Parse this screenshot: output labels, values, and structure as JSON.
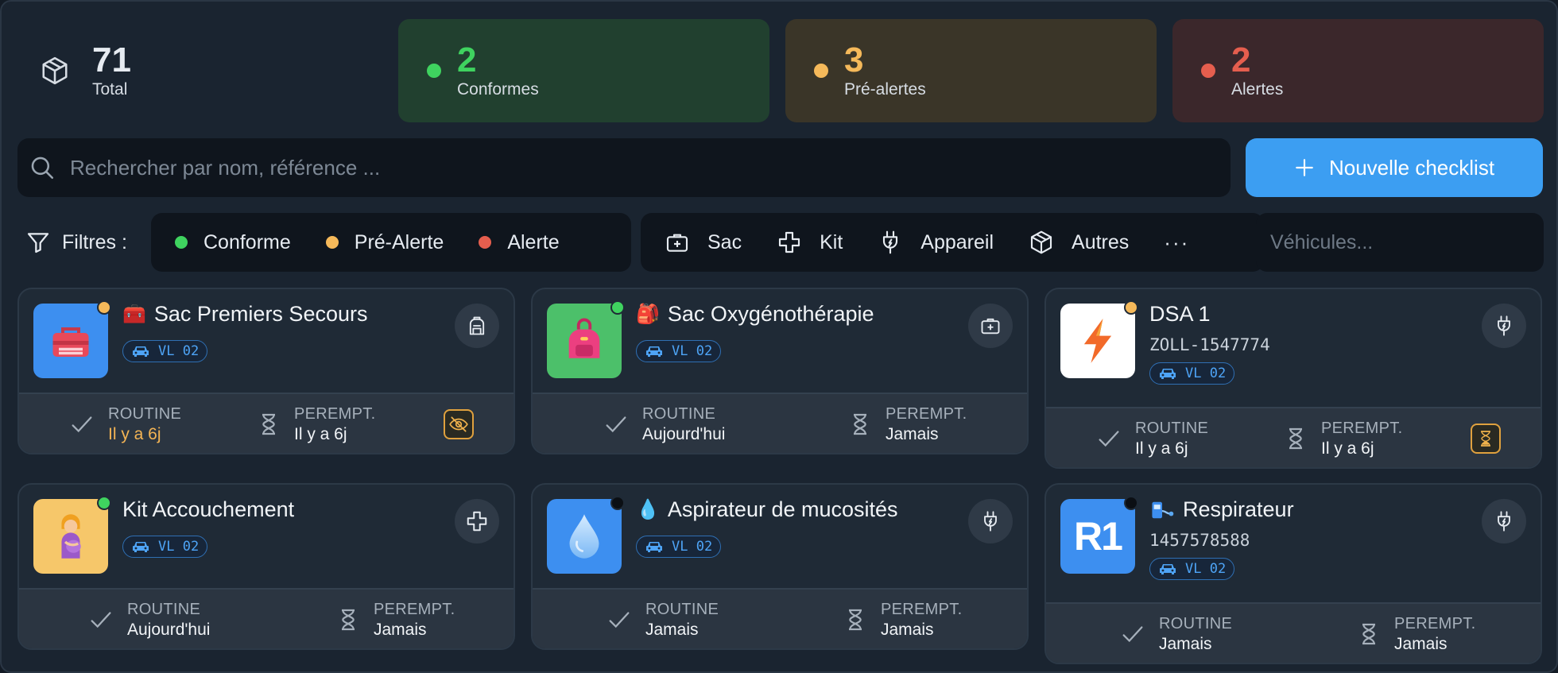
{
  "colors": {
    "ok": "#3fd35f",
    "warn": "#f5b95a",
    "alert": "#e55e4e",
    "accent": "#3c9ef2",
    "vehicle": "#4ea4f6",
    "unknown": "#0b0f14"
  },
  "stats": {
    "total": {
      "value": "71",
      "label": "Total",
      "icon": "box-icon"
    },
    "conformes": {
      "value": "2",
      "label": "Conformes"
    },
    "prealertes": {
      "value": "3",
      "label": "Pré-alertes"
    },
    "alertes": {
      "value": "2",
      "label": "Alertes"
    }
  },
  "search": {
    "placeholder": "Rechercher par nom, référence ...",
    "value": ""
  },
  "new_button": {
    "label": "Nouvelle checklist",
    "icon": "plus-icon"
  },
  "filters": {
    "label": "Filtres :",
    "status": [
      {
        "label": "Conforme",
        "color": "#3fd35f"
      },
      {
        "label": "Pré-Alerte",
        "color": "#f5b95a"
      },
      {
        "label": "Alerte",
        "color": "#e55e4e"
      }
    ],
    "types": [
      {
        "label": "Sac",
        "icon": "medical-bag-icon"
      },
      {
        "label": "Kit",
        "icon": "cross-icon"
      },
      {
        "label": "Appareil",
        "icon": "plug-icon"
      },
      {
        "label": "Autres",
        "icon": "box-icon"
      }
    ],
    "more": "···",
    "vehicles_placeholder": "Véhicules..."
  },
  "cards": [
    {
      "title": "Sac Premiers Secours",
      "emoji": "🧰",
      "vehicle": "VL 02",
      "ref": "",
      "routine_label": "ROUTINE",
      "routine": "Il y a 6j",
      "peremption_label": "PEREMPT.",
      "peremption": "Il y a 6j",
      "status": "warn",
      "action_icon": "backpack-icon",
      "badge_icon": "eye-off-icon"
    },
    {
      "title": "Sac Oxygénothérapie",
      "emoji": "🎒",
      "vehicle": "VL 02",
      "ref": "",
      "routine_label": "ROUTINE",
      "routine": "Aujourd'hui",
      "peremption_label": "PEREMPT.",
      "peremption": "Jamais",
      "status": "ok",
      "action_icon": "medical-bag-icon"
    },
    {
      "title": "DSA 1",
      "emoji": "",
      "vehicle": "VL 02",
      "ref": "ZOLL-1547774",
      "routine_label": "ROUTINE",
      "routine": "Il y a 6j",
      "peremption_label": "PEREMPT.",
      "peremption": "Il y a 6j",
      "status": "warn",
      "action_icon": "plug-icon",
      "badge_icon": "hourglass-icon"
    },
    {
      "title": "Kit Accouchement",
      "emoji": "",
      "vehicle": "VL 02",
      "ref": "",
      "routine_label": "ROUTINE",
      "routine": "Aujourd'hui",
      "peremption_label": "PEREMPT.",
      "peremption": "Jamais",
      "status": "ok",
      "action_icon": "cross-icon"
    },
    {
      "title": "Aspirateur de mucosités",
      "emoji": "💧",
      "vehicle": "VL 02",
      "ref": "",
      "routine_label": "ROUTINE",
      "routine": "Jamais",
      "peremption_label": "PEREMPT.",
      "peremption": "Jamais",
      "status": "unknown",
      "action_icon": "plug-icon"
    },
    {
      "title": "Respirateur",
      "emoji": "",
      "vehicle": "VL 02",
      "ref": "1457578588",
      "thumb_text": "R1",
      "routine_label": "ROUTINE",
      "routine": "Jamais",
      "peremption_label": "PEREMPT.",
      "peremption": "Jamais",
      "status": "unknown",
      "action_icon": "plug-icon"
    }
  ]
}
